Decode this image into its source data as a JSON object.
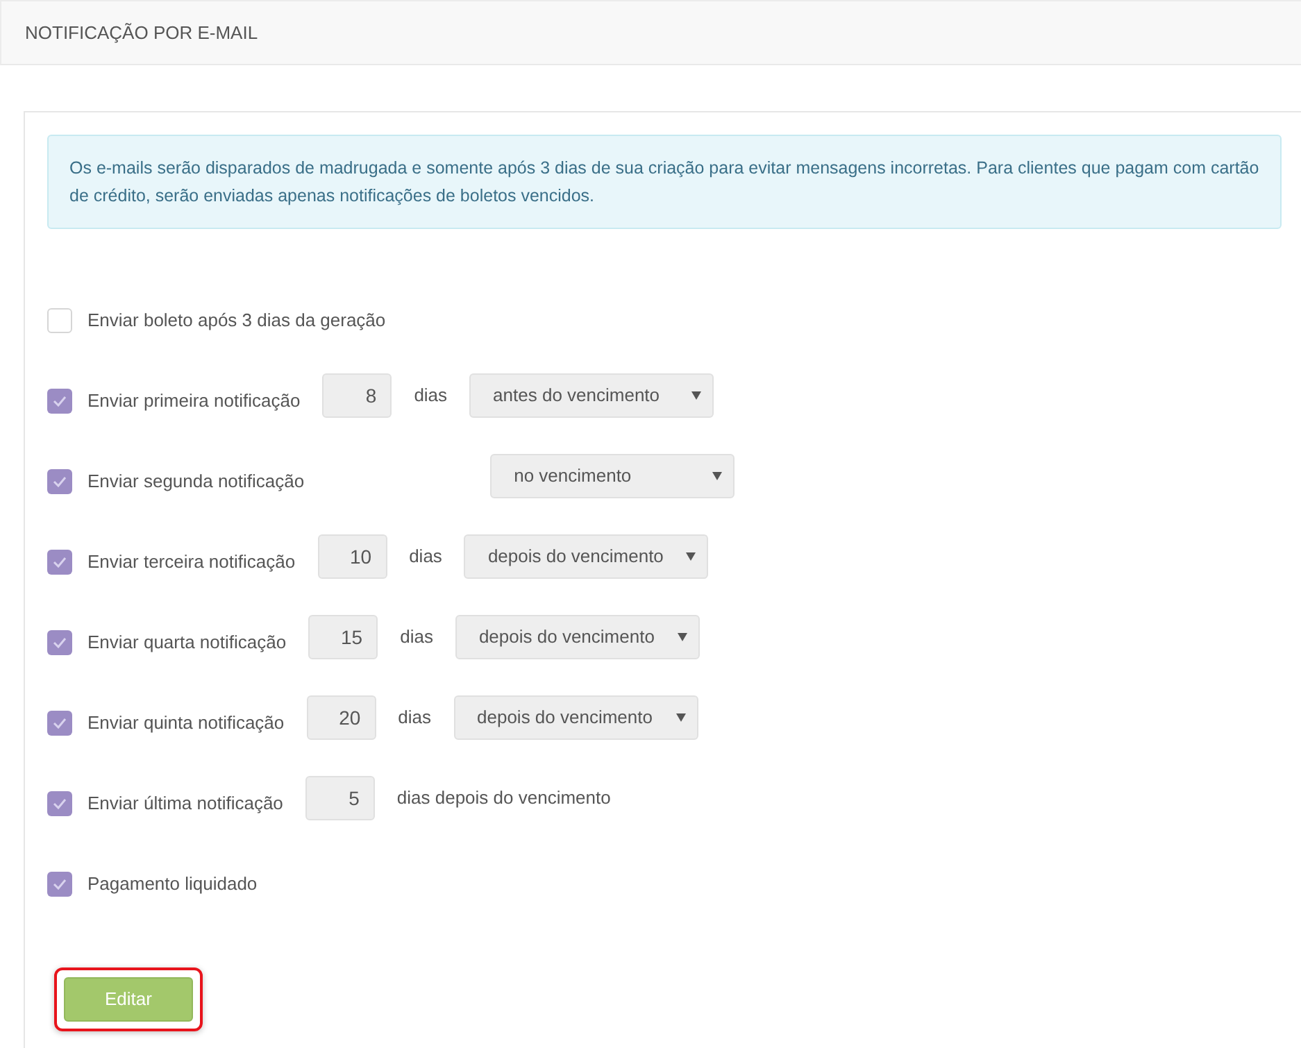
{
  "header": {
    "title": "NOTIFICAÇÃO POR E-MAIL"
  },
  "alert": {
    "text": "Os e-mails serão disparados de madrugada e somente após 3 dias de sua criação para evitar mensagens incorretas. Para clientes que pagam com cartão de crédito, serão enviadas apenas notificações de boletos vencidos."
  },
  "options": [
    {
      "kind": "checkbox",
      "label": "Enviar boleto após 3 dias da geração",
      "checked": false
    },
    {
      "kind": "days_select",
      "label": "Enviar primeira notificação",
      "checked": true,
      "days": "8",
      "unit": "dias",
      "select": "antes do vencimento"
    },
    {
      "kind": "select",
      "label": "Enviar segunda notificação",
      "checked": true,
      "select": "no vencimento"
    },
    {
      "kind": "days_select",
      "label": "Enviar terceira notificação",
      "checked": true,
      "days": "10",
      "unit": "dias",
      "select": "depois do vencimento"
    },
    {
      "kind": "days_select",
      "label": "Enviar quarta notificação",
      "checked": true,
      "days": "15",
      "unit": "dias",
      "select": "depois do vencimento"
    },
    {
      "kind": "days_select",
      "label": "Enviar quinta notificação",
      "checked": true,
      "days": "20",
      "unit": "dias",
      "select": "depois do vencimento"
    },
    {
      "kind": "days_suffix",
      "label": "Enviar última notificação",
      "checked": true,
      "days": "5",
      "unit": "dias depois do vencimento"
    },
    {
      "kind": "checkbox",
      "label": "Pagamento liquidado",
      "checked": true
    }
  ],
  "button": {
    "label": "Editar",
    "highlighted": true
  }
}
